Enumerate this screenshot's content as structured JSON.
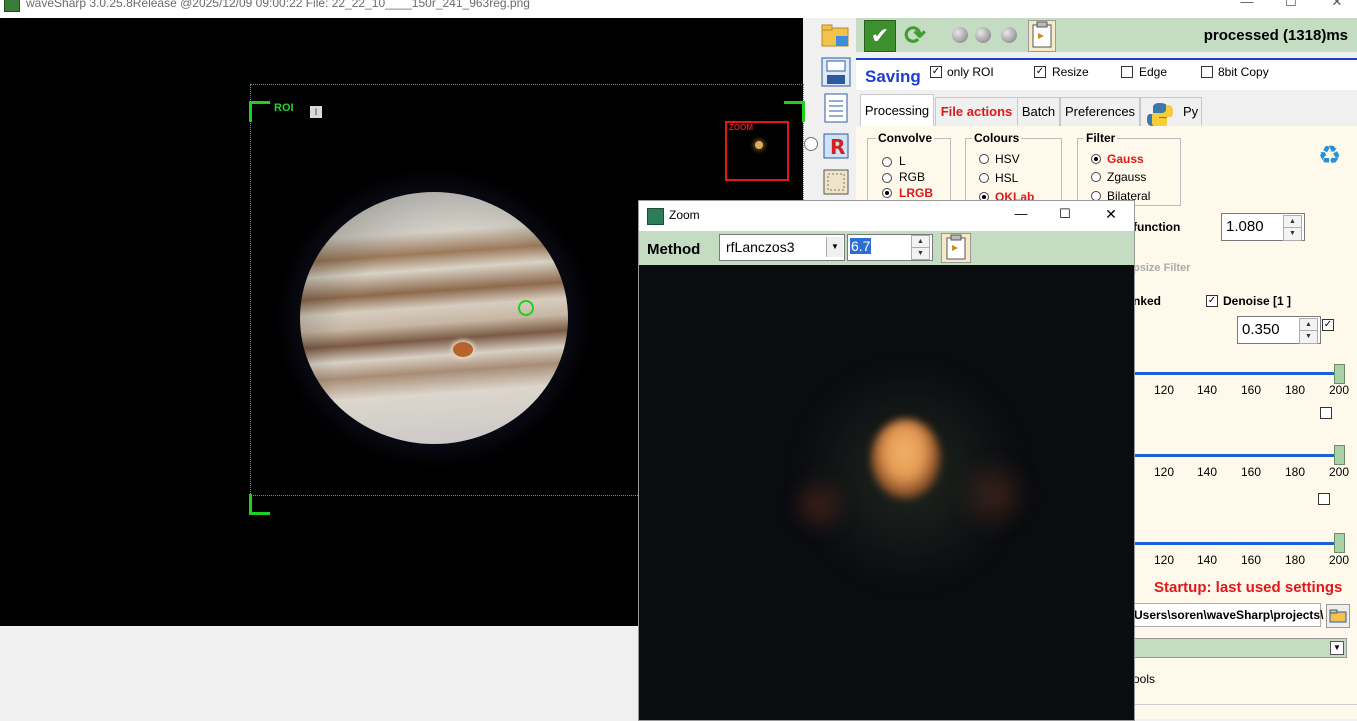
{
  "titlebar": {
    "title": "waveSharp 3.0.25.8Release @2025/12/09 09:00:22    File: 22_22_10____150r_241_963reg.png",
    "min": "—",
    "max": "☐",
    "close": "✕"
  },
  "image": {
    "roi_label": "ROI",
    "roi_marker": "I",
    "zoom_label": "ZOOM"
  },
  "toolbar": {
    "status": "processed (1318)ms"
  },
  "saving": {
    "label": "Saving",
    "only_roi": {
      "label": "only ROI",
      "checked": true
    },
    "resize": {
      "label": "Resize",
      "checked": true
    },
    "edge": {
      "label": "Edge",
      "checked": false
    },
    "eightbit": {
      "label": "8bit Copy",
      "checked": false
    }
  },
  "tabs": [
    {
      "label": "Processing",
      "active": true
    },
    {
      "label": "File actions",
      "active": false
    },
    {
      "label": "Batch",
      "active": false
    },
    {
      "label": "Preferences",
      "active": false
    },
    {
      "label": "Py",
      "active": false
    }
  ],
  "convolve": {
    "title": "Convolve",
    "options": [
      "L",
      "RGB",
      "LRGB"
    ],
    "selected": "LRGB"
  },
  "colours": {
    "title": "Colours",
    "options": [
      "HSV",
      "HSL",
      "OKLab"
    ],
    "selected": "OKLab"
  },
  "filter": {
    "title": "Filter",
    "options": [
      "Gauss",
      "Zgauss",
      "Bilateral"
    ],
    "selected": "Gauss"
  },
  "params": {
    "function_label": "function",
    "function_value": "1.080",
    "filter_label": "psize Filter",
    "linked_label": "nked",
    "denoise_label": "Denoise [1 ]",
    "denoise_checked": true,
    "denoise_value": "0.350"
  },
  "sliders": [
    {
      "ticks": [
        "120",
        "140",
        "160",
        "180",
        "200"
      ],
      "level": 1.0
    },
    {
      "ticks": [
        "120",
        "140",
        "160",
        "180",
        "200"
      ],
      "level": 1.0
    },
    {
      "ticks": [
        "120",
        "140",
        "160",
        "180",
        "200"
      ],
      "level": 1.0
    }
  ],
  "startup": {
    "text": "Startup: last used settings",
    "path": "Users\\soren\\waveSharp\\projects\\",
    "tools_label": "ools"
  },
  "zoom_window": {
    "title": "Zoom",
    "method_label": "Method",
    "method_value": "rfLanczos3",
    "factor_value": "6.7",
    "min": "—",
    "max": "☐",
    "close": "✕"
  },
  "colors": {
    "accent_green": "#c3dcc2",
    "saving_blue": "#1c3fcf",
    "alert_red": "#e01818",
    "roi_green": "#1fd11f"
  }
}
